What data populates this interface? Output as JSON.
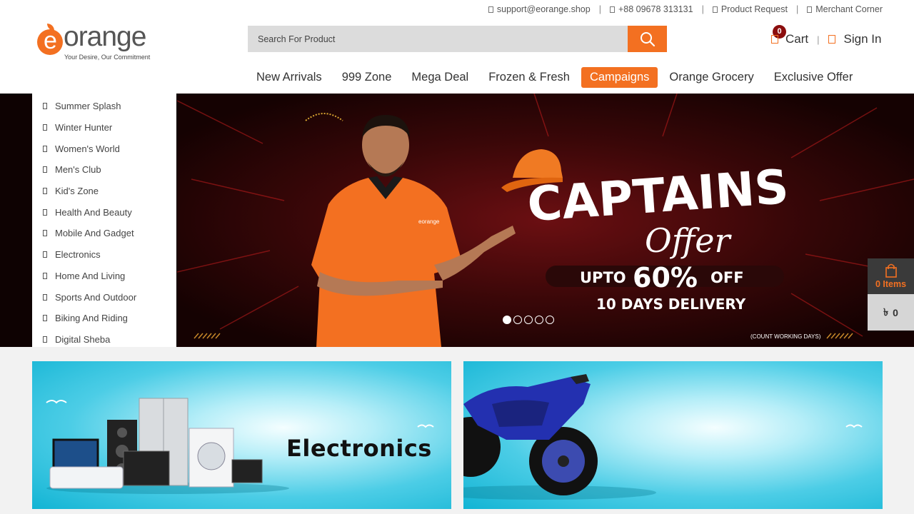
{
  "topbar": {
    "email": "support@eorange.shop",
    "phone": "+88 09678 313131",
    "product_request": "Product Request",
    "merchant_corner": "Merchant Corner",
    "separator": "|"
  },
  "logo": {
    "brand_e": "e",
    "brand_rest": "orange",
    "tagline": "Your Desire, Our Commitment",
    "color": "#f37021"
  },
  "search": {
    "placeholder": "Search For Product",
    "icon": "search-icon"
  },
  "header": {
    "cart_label": "Cart",
    "cart_count": "0",
    "signin_label": "Sign In"
  },
  "nav": {
    "items": [
      {
        "label": "New Arrivals"
      },
      {
        "label": "999 Zone"
      },
      {
        "label": "Mega Deal"
      },
      {
        "label": "Frozen & Fresh"
      },
      {
        "label": "Campaigns",
        "active": true
      },
      {
        "label": "Orange Grocery"
      },
      {
        "label": "Exclusive Offer"
      }
    ]
  },
  "sidebar": {
    "items": [
      {
        "label": "Summer Splash"
      },
      {
        "label": "Winter Hunter"
      },
      {
        "label": "Women's World"
      },
      {
        "label": "Men's Club"
      },
      {
        "label": "Kid's Zone"
      },
      {
        "label": "Health And Beauty"
      },
      {
        "label": "Mobile And Gadget"
      },
      {
        "label": "Electronics"
      },
      {
        "label": "Home And Living"
      },
      {
        "label": "Sports And Outdoor"
      },
      {
        "label": "Biking And Riding"
      },
      {
        "label": "Digital Sheba"
      }
    ]
  },
  "banner": {
    "headline": "CAPTAINS",
    "script": "Offer",
    "offer_prefix": "UPTO",
    "offer_value": "60%",
    "offer_suffix": "OFF",
    "delivery": "10 DAYS DELIVERY",
    "footnote": "(COUNT WORKING DAYS)",
    "shirt_logo": "eorange",
    "slides_total": 5,
    "active_slide": 1,
    "accent": "#f37021"
  },
  "floating_cart": {
    "items_label": "0 Items",
    "currency": "৳",
    "amount": "0",
    "icon": "shopping-bag-icon"
  },
  "promos": [
    {
      "title": "Electronics"
    },
    {
      "title": ""
    }
  ],
  "colors": {
    "brand_orange": "#f37021",
    "cart_badge": "#8b0d0d"
  }
}
